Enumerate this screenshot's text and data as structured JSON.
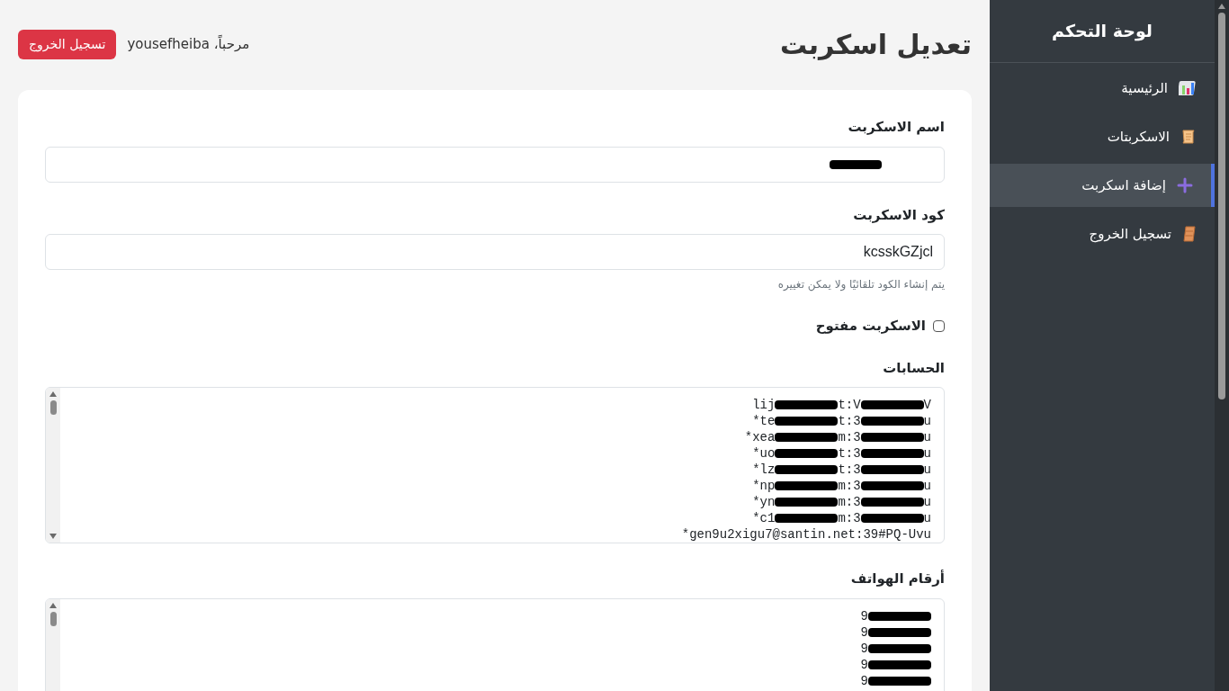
{
  "sidebar": {
    "title": "لوحة التحكم",
    "items": [
      {
        "label": "الرئيسية",
        "selected": false
      },
      {
        "label": "الاسكربتات",
        "selected": false
      },
      {
        "label": "إضافة اسكربت",
        "selected": true
      },
      {
        "label": "تسجيل الخروج",
        "selected": false
      }
    ]
  },
  "header": {
    "title": "تعديل اسكربت",
    "welcome": "مرحباً، yousefheiba",
    "logout_button": "تسجيل الخروج"
  },
  "form": {
    "name_field": {
      "label": "اسم الاسكربت",
      "redacted": true
    },
    "code_field": {
      "label": "كود الاسكربت",
      "value": "kcsskGZjcl",
      "hint": "يتم إنشاء الكود تلقائيًا ولا يمكن تغييره"
    },
    "open_checkbox": {
      "label": "الاسكربت مفتوح",
      "checked": false
    },
    "accounts": {
      "label": "الحسابات",
      "lines": [
        {
          "prefix": "lij",
          "middle": "t:V",
          "suffix": "V",
          "redacted": true
        },
        {
          "prefix": "*te",
          "middle": "t:3",
          "suffix": "u",
          "redacted": true
        },
        {
          "prefix": "*xea",
          "middle": "m:3",
          "suffix": "u",
          "redacted": true
        },
        {
          "prefix": "*uo",
          "middle": "t:3",
          "suffix": "u",
          "redacted": true
        },
        {
          "prefix": "*lz",
          "middle": "t:3",
          "suffix": "u",
          "redacted": true
        },
        {
          "prefix": "*np",
          "middle": "m:3",
          "suffix": "u",
          "redacted": true
        },
        {
          "prefix": "*yn",
          "middle": "m:3",
          "suffix": "u",
          "redacted": true
        },
        {
          "prefix": "*c1",
          "middle": "m:3",
          "suffix": "u",
          "redacted": true
        },
        {
          "prefix": "*gen9u2xigu7@santin.net:39#PQ-Uvu",
          "redacted": false
        }
      ]
    },
    "phones": {
      "label": "أرقام الهواتف",
      "lines": [
        {
          "prefix": "9",
          "redacted": true
        },
        {
          "prefix": "9",
          "redacted": true
        },
        {
          "prefix": "9",
          "redacted": true
        },
        {
          "prefix": "9",
          "redacted": true
        },
        {
          "prefix": "9",
          "redacted": true
        }
      ]
    }
  }
}
